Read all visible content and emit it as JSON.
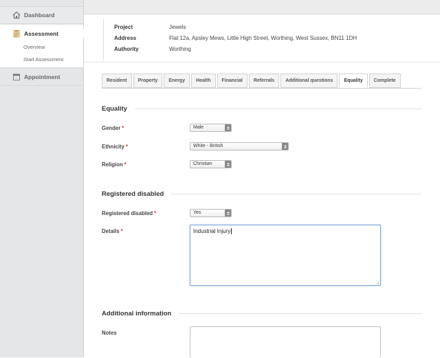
{
  "sidebar": {
    "dashboard": {
      "label": "Dashboard",
      "icon": "home-icon"
    },
    "assessment": {
      "label": "Assessment",
      "icon": "clipboard-icon"
    },
    "subitems": [
      {
        "label": "Overview"
      },
      {
        "label": "Start Assessment"
      }
    ],
    "appointment": {
      "label": "Appointment",
      "icon": "calendar-icon"
    }
  },
  "info": {
    "project": {
      "label": "Project",
      "value": "Jewels"
    },
    "address": {
      "label": "Address",
      "value": "Flat 12a, Apsley Mews, Little High Street, Worthing, West Sussex, BN11 1DH"
    },
    "authority": {
      "label": "Authority",
      "value": "Worthing"
    }
  },
  "tabs": [
    {
      "label": "Resident",
      "active": false
    },
    {
      "label": "Property",
      "active": false
    },
    {
      "label": "Energy",
      "active": false
    },
    {
      "label": "Health",
      "active": false
    },
    {
      "label": "Financial",
      "active": false
    },
    {
      "label": "Referrals",
      "active": false
    },
    {
      "label": "Additional questions",
      "active": false
    },
    {
      "label": "Equality",
      "active": true
    },
    {
      "label": "Complete",
      "active": false
    }
  ],
  "equality": {
    "title": "Equality",
    "gender": {
      "label": "Gender",
      "required": "*",
      "value": "Male"
    },
    "ethnicity": {
      "label": "Ethnicity",
      "required": "*",
      "value": "White - British"
    },
    "religion": {
      "label": "Religion",
      "required": "*",
      "value": "Christian"
    }
  },
  "disabled": {
    "title": "Registered disabled",
    "registered": {
      "label": "Registered disabled",
      "required": "*",
      "value": "Yes"
    },
    "details": {
      "label": "Details",
      "required": "*",
      "value": "Industrial Injury"
    }
  },
  "additional": {
    "title": "Additional information",
    "notes": {
      "label": "Notes",
      "value": ""
    }
  },
  "colors": {
    "focus_border": "#7fa7d8",
    "required": "#c0392b",
    "sidebar_bg": "#e5e6e8"
  }
}
